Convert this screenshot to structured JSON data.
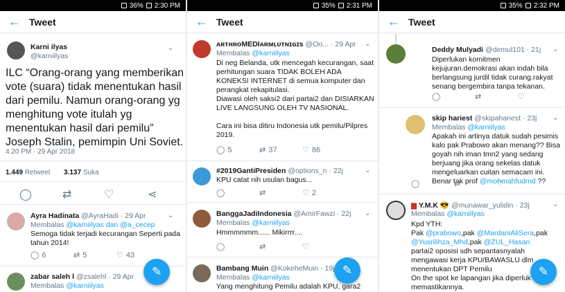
{
  "status": [
    {
      "battery": "36%",
      "time": "2:30 PM"
    },
    {
      "battery": "35%",
      "time": "2:31 PM"
    },
    {
      "battery": "35%",
      "time": "2:32 PM"
    }
  ],
  "title": "Tweet",
  "main": {
    "name": "Karni ilyas",
    "handle": "@karniilyas",
    "text": "ILC “Orang-orang yang memberikan vote (suara) tidak menentukan hasil dari pemilu. Namun orang-orang yg menghitung vote itulah yg menentukan hasil dari pemilu” Joseph Stalin, pemimpin Uni Soviet.",
    "time": "4.20 PM · 29 Apr 2018",
    "retweets": "1.449",
    "retweet_label": "Retweet",
    "likes": "3.137",
    "likes_label": "Suka"
  },
  "reply_prefix": "Membalas ",
  "p1": [
    {
      "name": "Ayra Hadinata",
      "handle": "@AyraHadi · 29 Apr",
      "to": "@karniilyas dan @a_cecep",
      "text": "Semoga tidak terjadi kecurangan Seperti pada tahun 2014!",
      "c": "6",
      "r": "5",
      "l": "43"
    },
    {
      "name": "zabar saleh l",
      "handle": "@zsalehl · 29 Apr",
      "to": "@karniilyas"
    }
  ],
  "p2": [
    {
      "name": "ᴀʀᴛʜʀᴏMEDIᴀʀᴍʟᴜᴛɴɪɢɪs",
      "handle": "@Oo... · 29 Apr",
      "to": "@karniilyas",
      "text": "Di neg Belanda, utk mencegah kecurangan, saat perhitungan suara TIDAK BOLEH ADA KONEKSI INTERNET di semua komputer dan perangkat rekapitulasi.\nDiawasi oleh saksi2 dari partai2 dan DISIARKAN LIVE LANGSUNG OLEH TV NASIONAL.\n\nCara ini bisa ditiru Indonesia utk pemilu/Pilpres 2019.",
      "c": "5",
      "r": "37",
      "l": "86"
    },
    {
      "name": "#2019GantiPresiden",
      "handle": "@options_n · 22j",
      "text": "KPU catat nih usulan bagus...",
      "c": "",
      "r": "",
      "l": "2"
    },
    {
      "name": "BanggaJadiIndonesia",
      "handle": "@AmirFawzi · 22j",
      "to": "@karniilyas",
      "text": "Hmmmmmm...... Mikirrrr...."
    },
    {
      "name": "Bambang Muin",
      "handle": "@KokeheMuin · 19j",
      "to": "@karniilyas",
      "text": "Yang menghitung Pemilu adalah KPU, gara2"
    }
  ],
  "p3": [
    {
      "name": "Deddy Mulyadi",
      "handle": "@demul101 · 21j",
      "text": "Diperlukan komitmen kejujuran.demokrasi akan indah bila berlangsung jurdil tidak curang.rakyat senang bergembira tanpa tekanan."
    },
    {
      "name": "skip hariest",
      "handle": "@skipahariest · 23j",
      "to": "@karniilyas",
      "text": "Apakah ini artinya datuk sudah pesimis kalo pak Prabowo akan menang?? Bisa goyah nih iman tmn2 yang sedang berjuang jika orang sekelas datuk mengeluarkan cuitan semacam ini. Benar tak prof ",
      "tail": "@mohmahfudmd",
      "tail2": " ??"
    },
    {
      "name": "Y.M.K 😎",
      "handle": "@munawar_yulidin · 23j",
      "to": "@karniilyas",
      "l1": "Kpd YTH:",
      "l2a": "Pak ",
      "m1": "@prabowo",
      "l2b": ",pak ",
      "m2": "@MardaniAliSera",
      "l2c": ",pak",
      "m3": "@Yusrilihza_Mhd",
      "l3b": ",pak ",
      "m4": "@ZUL_Hasan",
      "text2": "partai2 oposisi sdh sepantasnyalah mengawasi kerja KPU/BAWASLU dlm menentukan DPT Pemilu\nOn the spot ke lapangan jika diperluk memastikannya."
    }
  ]
}
